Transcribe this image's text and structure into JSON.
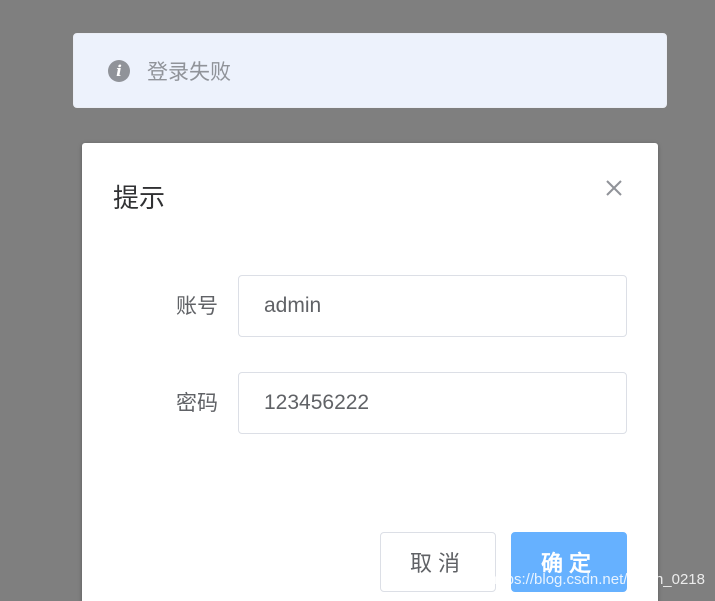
{
  "toast": {
    "message": "登录失败",
    "icon": "info-icon"
  },
  "dialog": {
    "title": "提示",
    "close_icon": "close-icon",
    "fields": [
      {
        "label": "账号",
        "value": "admin"
      },
      {
        "label": "密码",
        "value": "123456222"
      }
    ],
    "cancel_label": "取消",
    "confirm_label": "确定"
  },
  "watermark": "https://blog.csdn.net/Chen_0218",
  "colors": {
    "overlay": "#7f7f7f",
    "toast_bg": "#edf2fc",
    "primary_button": "#66b1ff",
    "text_secondary": "#909399"
  }
}
